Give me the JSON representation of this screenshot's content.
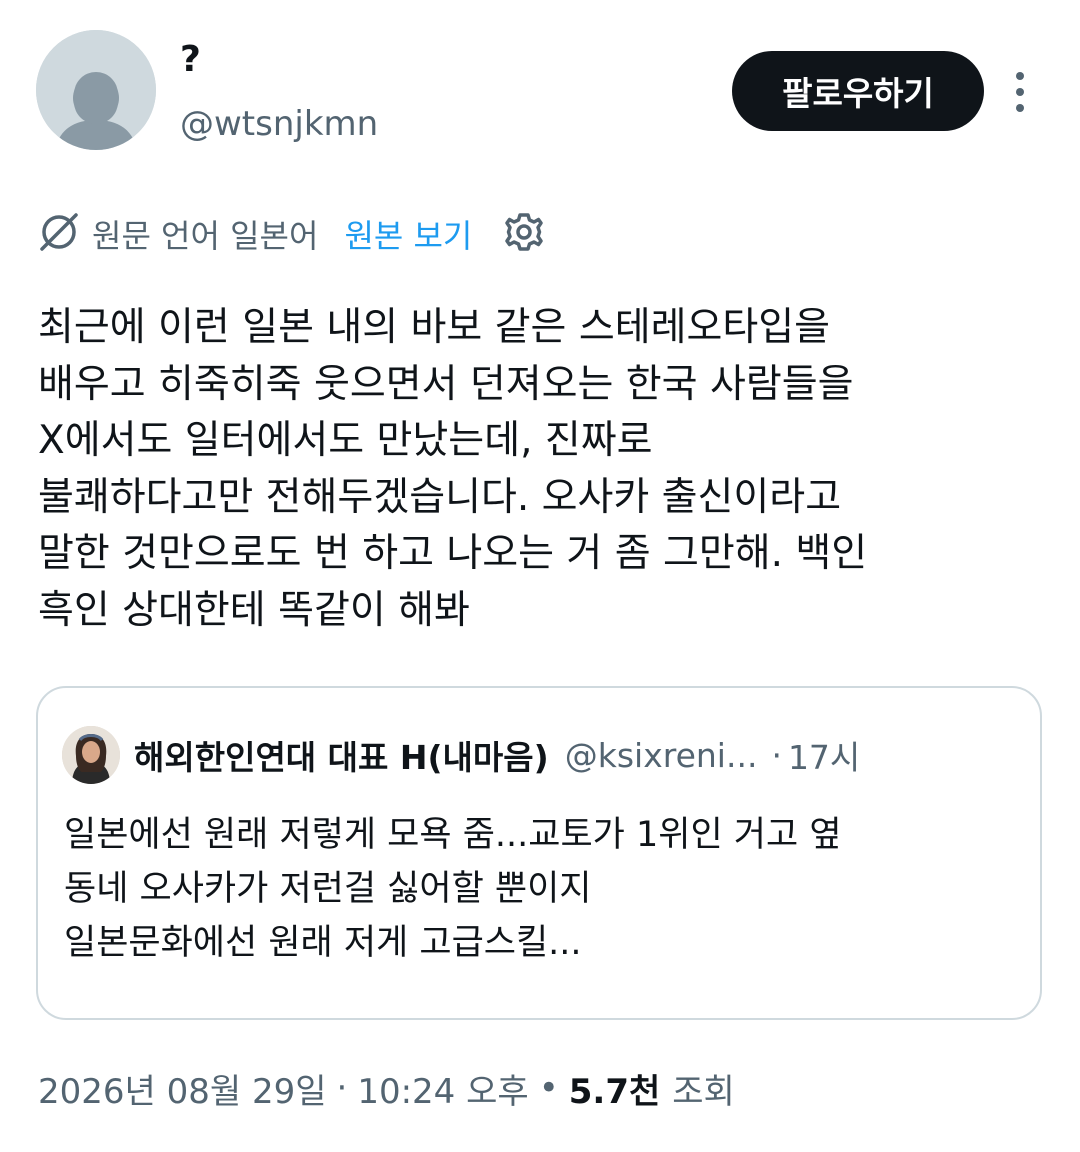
{
  "author": {
    "display_name": "?",
    "handle": "@wtsnjkmn",
    "avatar_icon": "default-profile-avatar"
  },
  "follow_button": {
    "label": "팔로우하기"
  },
  "more_menu": {
    "icon": "more-vertical-icon"
  },
  "translation": {
    "icon": "translate-icon",
    "source_language_text": "원문 언어 일본어",
    "view_original_label": "원본 보기",
    "settings_icon": "gear-icon"
  },
  "tweet": {
    "text": "최근에 이런 일본 내의 바보 같은 스테레오타입을\n배우고 히죽히죽 웃으면서 던져오는 한국 사람들을\nX에서도 일터에서도 만났는데, 진짜로\n불쾌하다고만 전해두겠습니다. 오사카 출신이라고\n말한 것만으로도 번 하고 나오는 거 좀 그만해. 백인\n흑인 상대한테 똑같이 해봐"
  },
  "quote": {
    "display_name": "해외한인연대 대표 H(내마음)",
    "handle": "@ksixreni...",
    "separator": "·",
    "time": "17시",
    "text": "일본에선 원래 저렇게 모욕 줌...교토가 1위인 거고 옆\n동네 오사카가 저런걸 싫어할 뿐이지\n일본문화에선 원래 저게 고급스킬..."
  },
  "meta": {
    "date": "2026년 08월 29일",
    "separator1": "·",
    "time": "10:24 오후",
    "separator2": "•",
    "views_count": "5.7천",
    "views_label": "조회"
  },
  "colors": {
    "text_primary": "#0f1419",
    "text_secondary": "#536471",
    "link_blue": "#1d9bf0",
    "border": "#cfd9de",
    "button_bg": "#0f1419"
  }
}
